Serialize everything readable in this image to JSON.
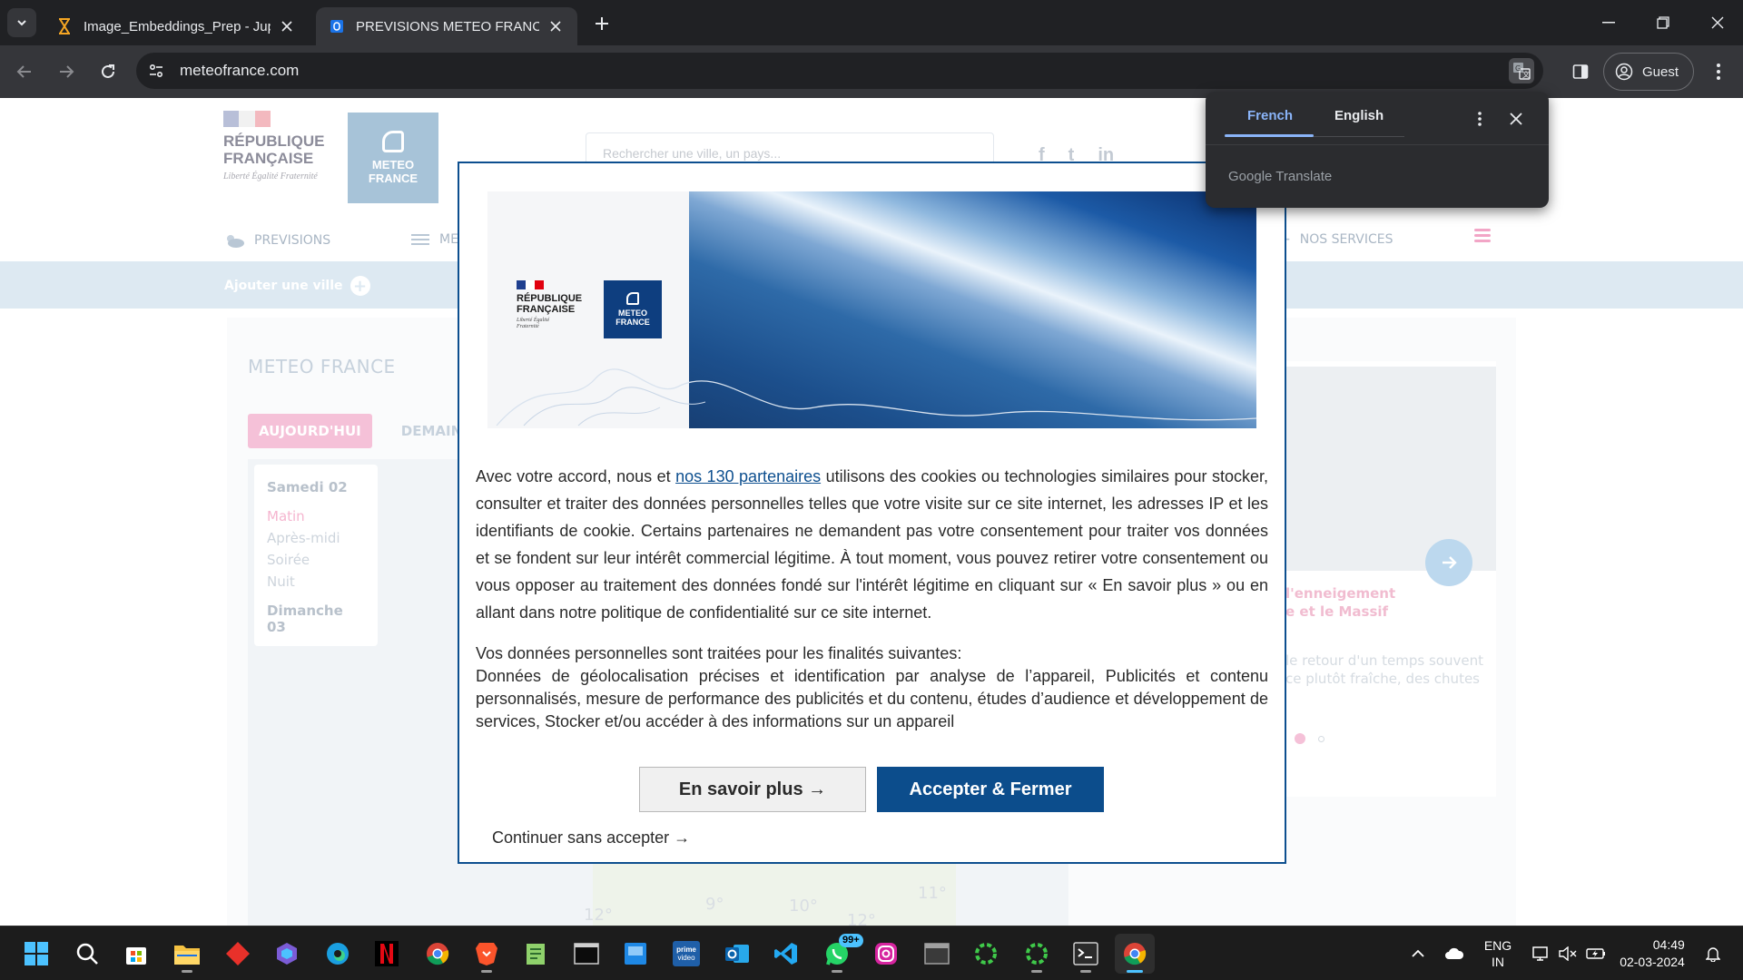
{
  "browser": {
    "tabs": [
      {
        "title": "Image_Embeddings_Prep - Jupyter",
        "active": false,
        "icon": "hourglass-icon"
      },
      {
        "title": "PREVISIONS METEO FRANCE - Site",
        "active": true,
        "icon": "meteofrance-favicon"
      }
    ],
    "url": "meteofrance.com",
    "profile_label": "Guest"
  },
  "page": {
    "rf_logo_text": "RÉPUBLIQUE FRANÇAISE",
    "rf_motto": "Liberté Égalité Fraternité",
    "mf_logo_text": "METEO FRANCE",
    "search_placeholder": "Rechercher une ville, un pays...",
    "nav": {
      "previsions": "PREVISIONS",
      "me": "ME",
      "services": "NOS SERVICES"
    },
    "add_city": "Ajouter une ville",
    "heading": "METEO FRANCE",
    "day_tabs": [
      "AUJOURD'HUI",
      "DEMAIN"
    ],
    "time_panel": {
      "day1": "Samedi 02",
      "slots": [
        "Matin",
        "Après-midi",
        "Soirée",
        "Nuit"
      ],
      "day2": "Dimanche 03"
    },
    "map_temps": [
      "12°",
      "9°",
      "10°",
      "12°",
      "11°"
    ],
    "news": {
      "title_lines": [
        "l'enneigement",
        "e et le Massif"
      ],
      "desc_lines": [
        "le retour d'un temps souvent",
        "ce plutôt fraîche, des chutes"
      ]
    }
  },
  "modal": {
    "rf_text": "RÉPUBLIQUE FRANÇAISE",
    "rf_motto": "Liberté Égalité Fraternité",
    "mf_text": "METEO FRANCE",
    "consent_before_link": "Avec votre accord, nous et ",
    "consent_link": "nos 130 partenaires",
    "consent_after_link": " utilisons des cookies ou technologies similaires pour stocker, consulter et traiter des données personnelles telles que votre visite sur ce site internet, les adresses IP et les identifiants de cookie. Certains partenaires ne demandent pas votre consentement pour traiter vos données et se fondent sur leur intérêt commercial légitime. À tout moment, vous pouvez retirer votre consentement ou vous opposer au traitement des données fondé sur l'intérêt légitime en cliquant sur « En savoir plus » ou en allant dans notre politique de confidentialité sur ce site internet.",
    "purposes_intro": "Vos données personnelles sont traitées pour les finalités suivantes:",
    "purposes_list": "Données de géolocalisation précises et identification par analyse de l’appareil, Publicités et contenu personnalisés, mesure de performance des publicités et du contenu, études d’audience et développement de services, Stocker et/ou accéder à des informations sur un appareil",
    "btn_more": "En savoir plus →",
    "btn_accept": "Accepter & Fermer",
    "continue": "Continuer sans accepter →"
  },
  "translate_popup": {
    "source_lang": "French",
    "target_lang": "English",
    "brand": "Google Translate"
  },
  "taskbar": {
    "apps": [
      "start",
      "search",
      "store",
      "file-explorer",
      "app-red",
      "copilot",
      "edge",
      "netflix",
      "chrome",
      "brave",
      "notepad",
      "terminal-dark",
      "app-blue",
      "prime-video",
      "outlook",
      "vscode",
      "whatsapp",
      "instagram",
      "app-window",
      "spinner-1",
      "spinner-2",
      "terminal",
      "chrome-active"
    ],
    "whatsapp_badge": "99+",
    "prime_label": "prime video",
    "lang_line1": "ENG",
    "lang_line2": "IN",
    "time": "04:49",
    "date": "02-03-2024"
  },
  "colors": {
    "modal_accent": "#0c4d8c",
    "page_pink": "#f5c1d8",
    "page_blue_bar": "#dde9f2",
    "translate_active": "#8ab4f8",
    "taskbar_accent": "#4cc2ff"
  }
}
